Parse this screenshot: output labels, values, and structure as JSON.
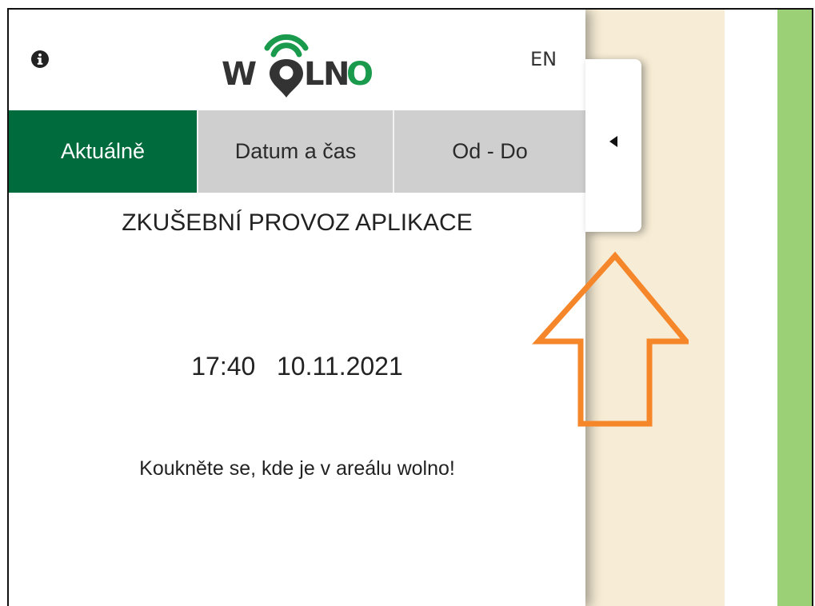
{
  "header": {
    "info_icon": "info-circle-icon",
    "logo_text": "WOLNO",
    "language_label": "EN"
  },
  "tabs": [
    {
      "label": "Aktuálně",
      "active": true
    },
    {
      "label": "Datum a čas",
      "active": false
    },
    {
      "label": "Od - Do",
      "active": false
    }
  ],
  "content": {
    "notice": "ZKUŠEBNÍ PROVOZ APLIKACE",
    "time": "17:40",
    "date": "10.11.2021",
    "tagline": "Koukněte se, kde je v areálu wolno!"
  },
  "toggle": {
    "icon": "caret-left-icon"
  },
  "annotation": {
    "icon": "arrow-up-outline-icon",
    "color": "#f5862a"
  },
  "colors": {
    "brand_green": "#006b3c",
    "tab_inactive": "#cfcfcf",
    "map_beige": "#f7edd6",
    "map_green": "#9bd076",
    "annotation_orange": "#f5862a"
  }
}
